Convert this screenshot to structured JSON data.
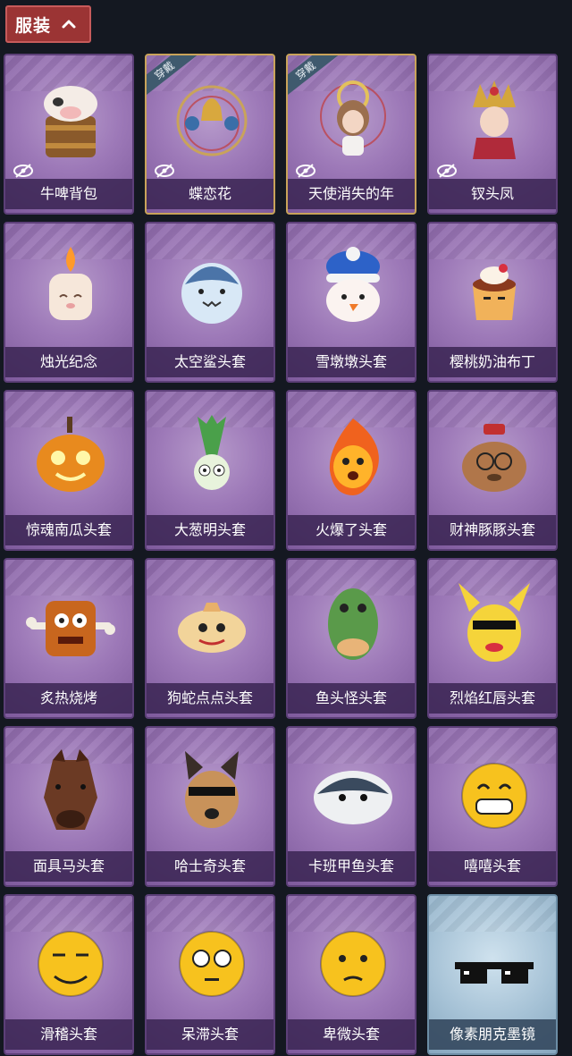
{
  "header": {
    "tab_label": "服装"
  },
  "status_labels": {
    "equipped": "穿戴"
  },
  "items": [
    {
      "name": "牛啤背包",
      "icon": "cow-beer-backpack",
      "equipped": false,
      "hidden": true,
      "style": "purple"
    },
    {
      "name": "蝶恋花",
      "icon": "butterfly-bell-wreath",
      "equipped": true,
      "hidden": true,
      "style": "purple"
    },
    {
      "name": "天使消失的年",
      "icon": "angel-doll",
      "equipped": true,
      "hidden": true,
      "style": "purple"
    },
    {
      "name": "钗头凤",
      "icon": "phoenix-crown-doll",
      "equipped": false,
      "hidden": true,
      "style": "purple"
    },
    {
      "name": "烛光纪念",
      "icon": "candle",
      "equipped": false,
      "hidden": false,
      "style": "purple"
    },
    {
      "name": "太空鲨头套",
      "icon": "shark-head",
      "equipped": false,
      "hidden": false,
      "style": "purple"
    },
    {
      "name": "雪墩墩头套",
      "icon": "snowman-head",
      "equipped": false,
      "hidden": false,
      "style": "purple"
    },
    {
      "name": "樱桃奶油布丁",
      "icon": "pudding",
      "equipped": false,
      "hidden": false,
      "style": "purple"
    },
    {
      "name": "惊魂南瓜头套",
      "icon": "pumpkin-head",
      "equipped": false,
      "hidden": false,
      "style": "purple"
    },
    {
      "name": "大葱明头套",
      "icon": "scallion-head",
      "equipped": false,
      "hidden": false,
      "style": "purple"
    },
    {
      "name": "火爆了头套",
      "icon": "fire-head",
      "equipped": false,
      "hidden": false,
      "style": "purple"
    },
    {
      "name": "财神豚豚头套",
      "icon": "capybara-head",
      "equipped": false,
      "hidden": false,
      "style": "purple"
    },
    {
      "name": "炙热烧烤",
      "icon": "bbq-meat",
      "equipped": false,
      "hidden": false,
      "style": "purple"
    },
    {
      "name": "狗蛇点点头套",
      "icon": "snake-head",
      "equipped": false,
      "hidden": false,
      "style": "purple"
    },
    {
      "name": "鱼头怪头套",
      "icon": "fish-head",
      "equipped": false,
      "hidden": false,
      "style": "purple"
    },
    {
      "name": "烈焰红唇头套",
      "icon": "pikachu-head",
      "equipped": false,
      "hidden": false,
      "style": "purple"
    },
    {
      "name": "面具马头套",
      "icon": "horse-head",
      "equipped": false,
      "hidden": false,
      "style": "purple"
    },
    {
      "name": "哈士奇头套",
      "icon": "husky-head",
      "equipped": false,
      "hidden": false,
      "style": "purple"
    },
    {
      "name": "卡班甲鱼头套",
      "icon": "turtle-head",
      "equipped": false,
      "hidden": false,
      "style": "purple"
    },
    {
      "name": "嘻嘻头套",
      "icon": "grin-emoji-head",
      "equipped": false,
      "hidden": false,
      "style": "purple"
    },
    {
      "name": "滑稽头套",
      "icon": "smirk-emoji-head",
      "equipped": false,
      "hidden": false,
      "style": "purple"
    },
    {
      "name": "呆滞头套",
      "icon": "stare-emoji-head",
      "equipped": false,
      "hidden": false,
      "style": "purple"
    },
    {
      "name": "卑微头套",
      "icon": "pleading-emoji-head",
      "equipped": false,
      "hidden": false,
      "style": "purple"
    },
    {
      "name": "像素朋克墨镜",
      "icon": "pixel-sunglasses",
      "equipped": false,
      "hidden": false,
      "style": "blue"
    }
  ]
}
